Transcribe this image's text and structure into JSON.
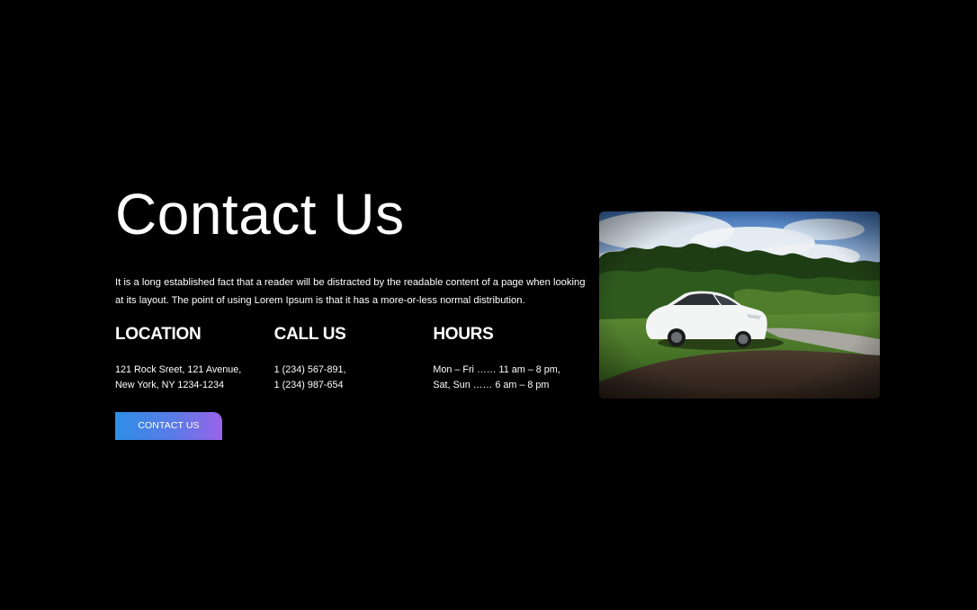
{
  "contact": {
    "title": "Contact Us",
    "description": "It is a long established fact that a reader will be distracted by the readable content of a page when looking at its layout. The point of using Lorem Ipsum is that it has a more-or-less normal distribution.",
    "columns": [
      {
        "heading": "LOCATION",
        "lines": [
          "121 Rock Sreet, 121 Avenue,",
          "New York, NY 1234-1234"
        ]
      },
      {
        "heading": "CALL US",
        "lines": [
          "1 (234) 567-891,",
          "1 (234) 987-654"
        ]
      },
      {
        "heading": "HOURS",
        "lines": [
          "Mon – Fri …… 11 am – 8 pm,",
          "Sat, Sun …… 6 am – 8 pm"
        ]
      }
    ],
    "button_label": "CONTACT US"
  },
  "photo": {
    "subject": "white car parked on grass near trees"
  },
  "colors": {
    "background": "#000000",
    "text": "#ffffff",
    "button_gradient_start": "#2d8ee6",
    "button_gradient_end": "#9a63e8"
  }
}
